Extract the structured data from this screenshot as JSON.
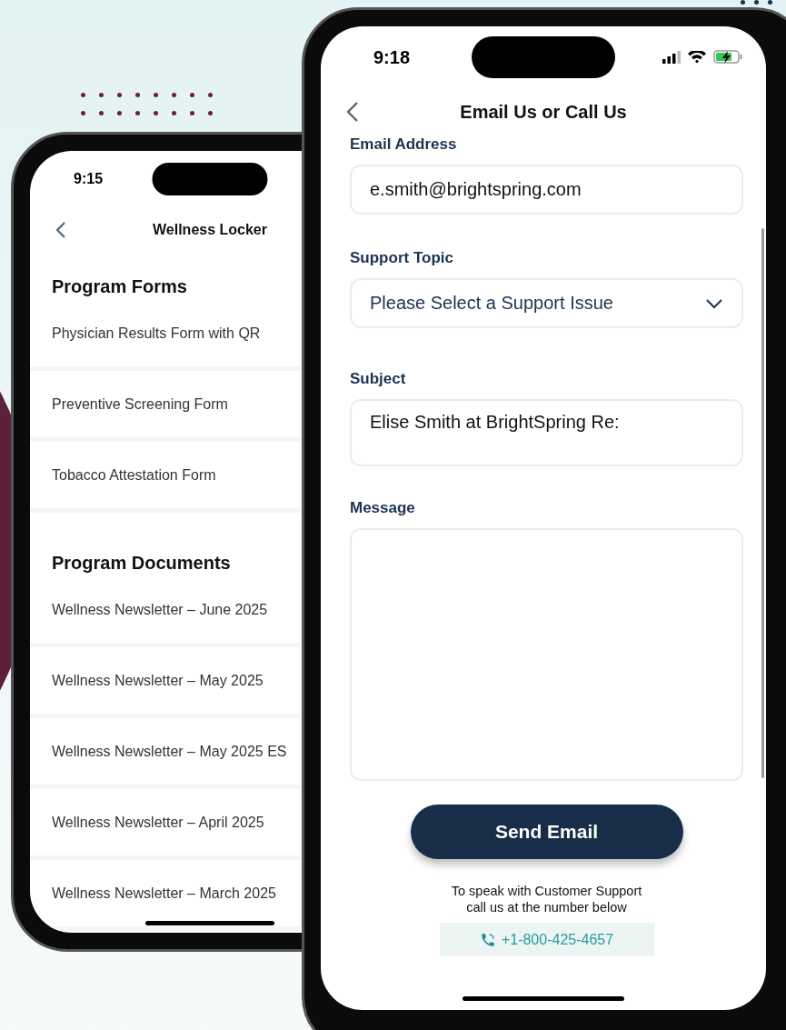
{
  "back_phone": {
    "status_bar": {
      "time": "9:15"
    },
    "header": {
      "title": "Wellness Locker"
    },
    "sections": [
      {
        "title": "Program Forms",
        "items": [
          "Physician Results Form with QR",
          "Preventive Screening Form",
          "Tobacco Attestation Form"
        ]
      },
      {
        "title": "Program Documents",
        "items": [
          "Wellness Newsletter – June 2025",
          "Wellness Newsletter – May 2025",
          "Wellness Newsletter – May 2025 ES",
          "Wellness Newsletter – April 2025",
          "Wellness Newsletter – March 2025"
        ]
      }
    ]
  },
  "front_phone": {
    "status_bar": {
      "time": "9:18"
    },
    "header": {
      "title": "Email Us or Call Us"
    },
    "fields": [
      {
        "kind": "text",
        "label": "Email Address",
        "value": "e.smith@brightspring.com"
      },
      {
        "kind": "select",
        "label": "Support Topic",
        "placeholder": "Please Select a Support Issue"
      },
      {
        "kind": "subject",
        "label": "Subject",
        "value": "Elise Smith at BrightSpring Re:"
      },
      {
        "kind": "message",
        "label": "Message"
      }
    ],
    "send_button": "Send Email",
    "support_note": [
      "To speak with Customer Support",
      "call us at the number below"
    ],
    "phone_number": "+1-800-425-4657"
  }
}
